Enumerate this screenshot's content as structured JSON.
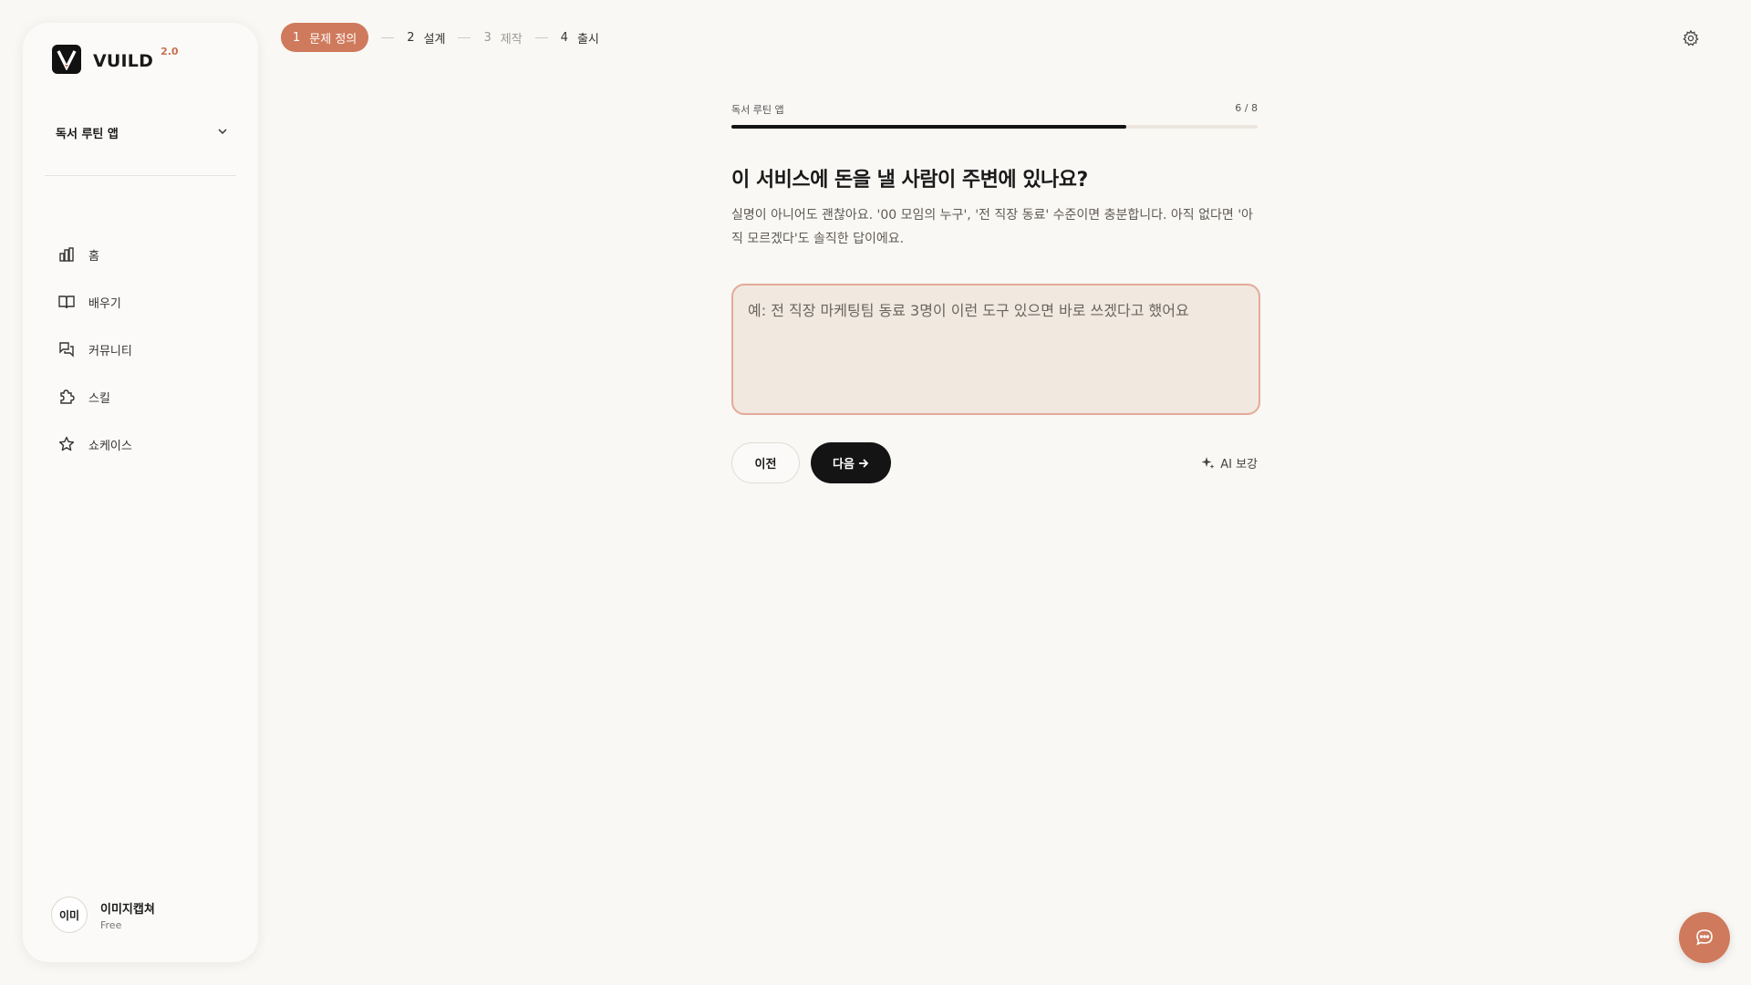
{
  "sidebar": {
    "logo_text": "VUILD",
    "logo_version": "2.0",
    "project_name": "독서 루틴 앱",
    "nav": [
      {
        "label": "홈",
        "icon": "chart-bar-icon"
      },
      {
        "label": "배우기",
        "icon": "book-open-icon"
      },
      {
        "label": "커뮤니티",
        "icon": "chat-bubbles-icon"
      },
      {
        "label": "스킬",
        "icon": "puzzle-icon"
      },
      {
        "label": "쇼케이스",
        "icon": "star-icon"
      }
    ],
    "user": {
      "avatar_text": "이미",
      "name": "이미지캡쳐",
      "plan": "Free"
    }
  },
  "stepper": {
    "steps": [
      {
        "num": "1",
        "label": "문제 정의",
        "state": "active"
      },
      {
        "num": "2",
        "label": "설계",
        "state": "normal"
      },
      {
        "num": "3",
        "label": "제작",
        "state": "muted"
      },
      {
        "num": "4",
        "label": "출시",
        "state": "normal"
      }
    ]
  },
  "main": {
    "progress_label": "독서 루틴 앱",
    "progress_count": "6 / 8",
    "progress_fraction": 0.75,
    "question": "이 서비스에 돈을 낼 사람이 주변에 있나요?",
    "hint": "실명이 아니어도 괜찮아요. '00 모임의 누구', '전 직장 동료' 수준이면 충분합니다. 아직 없다면 '아직 모르겠다'도 솔직한 답이에요.",
    "answer_value": "",
    "answer_placeholder": "예: 전 직장 마케팅팀 동료 3명이 이런 도구 있으면 바로 쓰겠다고 했어요",
    "prev_label": "이전",
    "next_label": "다음",
    "ai_label": "AI 보강"
  },
  "colors": {
    "accent": "#cf7a5c",
    "background": "#f9f8f5",
    "primary_button": "#141414",
    "textarea_bg": "#f1e8df",
    "textarea_border": "#e3aa98"
  }
}
